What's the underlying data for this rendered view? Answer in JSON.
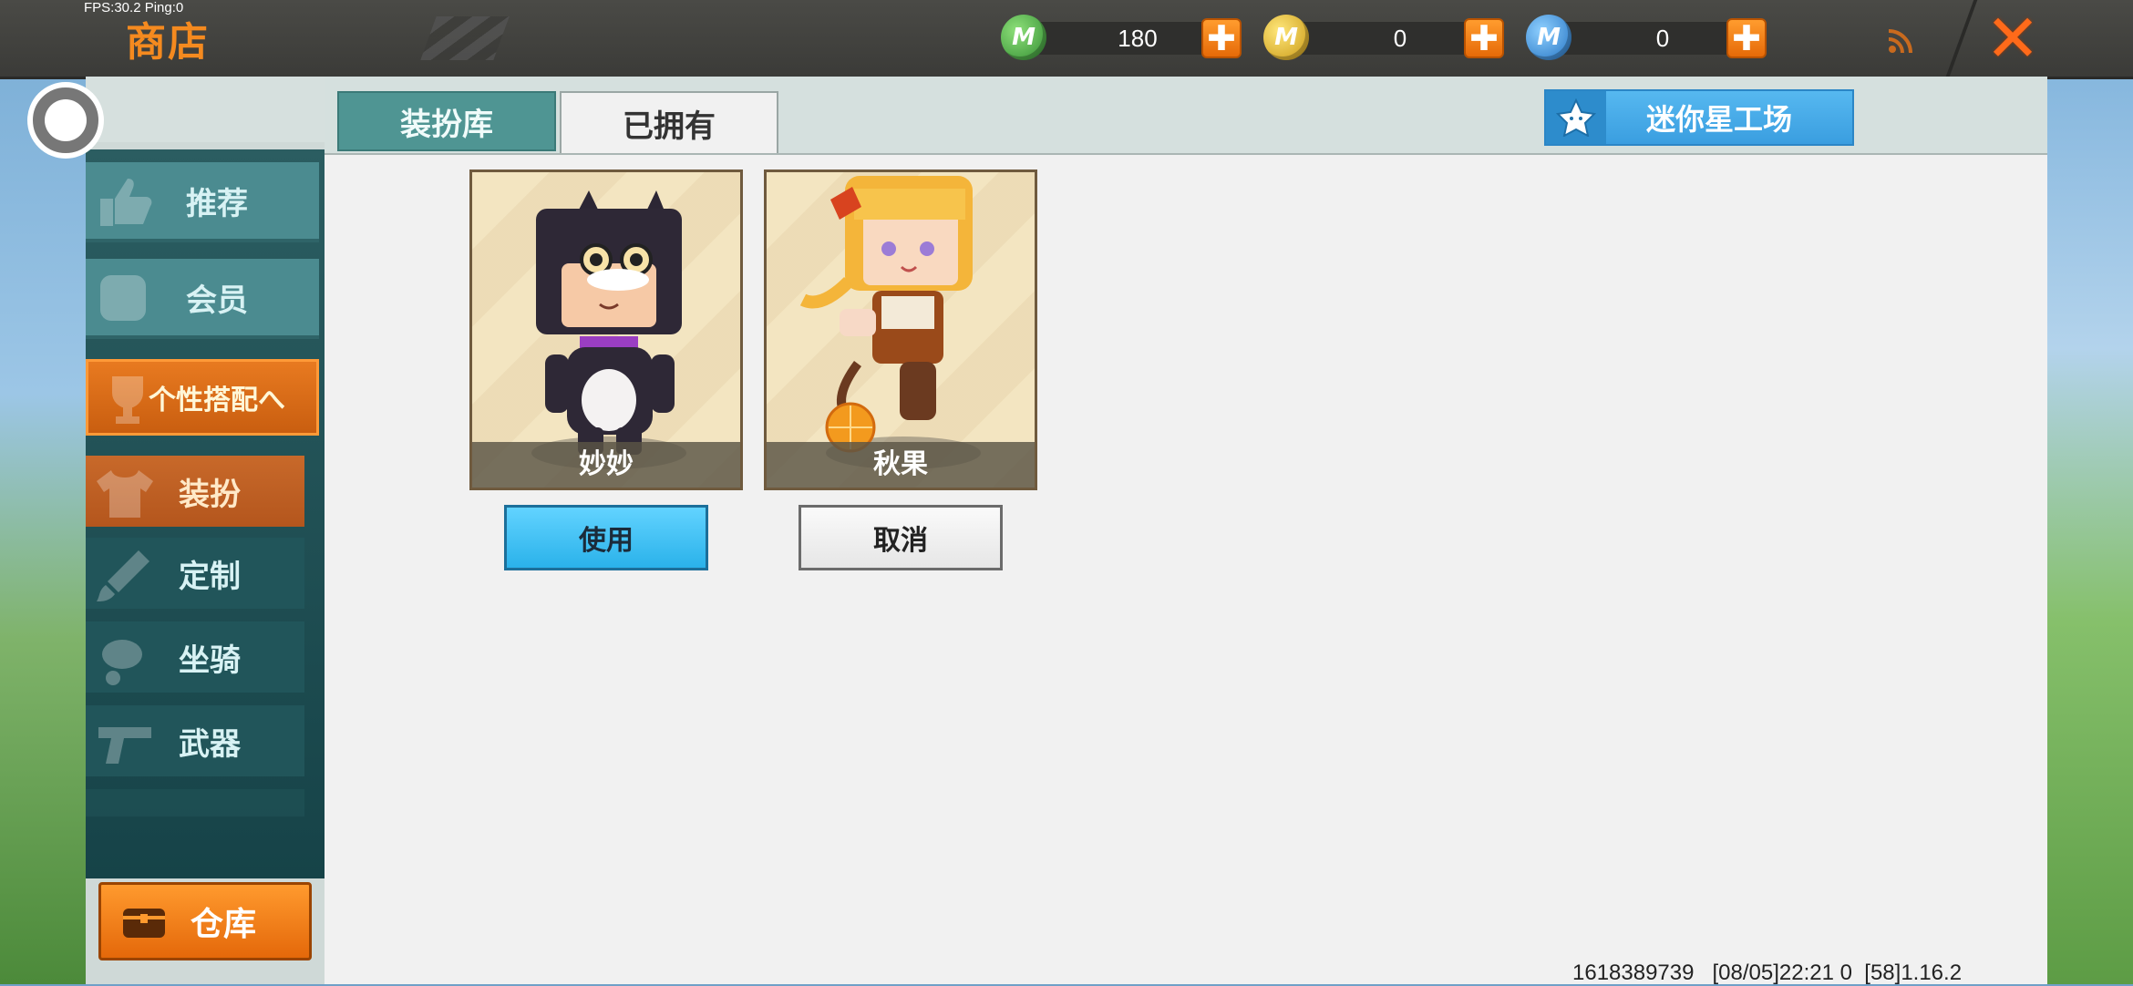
{
  "status": {
    "fps_text": "FPS:30.2  Ping:0"
  },
  "header": {
    "title": "商店",
    "currencies": [
      {
        "icon": "green-gem-icon",
        "value": "180",
        "color": "#3aa53a",
        "letter": "M"
      },
      {
        "icon": "gold-coin-icon",
        "value": "0",
        "color": "#e0b31c",
        "letter": "M"
      },
      {
        "icon": "blue-coin-icon",
        "value": "0",
        "color": "#2f8fdc",
        "letter": "M"
      }
    ],
    "plus_symbol": "✚",
    "close_symbol": "✕"
  },
  "sidebar": {
    "items": [
      {
        "label": "推荐",
        "icon": "thumbs-up-icon"
      },
      {
        "label": "会员",
        "icon": "member-icon"
      },
      {
        "label": "个性搭配へ",
        "icon": "trophy-icon"
      },
      {
        "label": "装扮",
        "icon": "shirt-icon"
      },
      {
        "label": "定制",
        "icon": "brush-icon"
      },
      {
        "label": "坐骑",
        "icon": "mount-icon"
      },
      {
        "label": "武器",
        "icon": "gun-icon"
      }
    ],
    "warehouse_label": "仓库"
  },
  "tabs": [
    {
      "label": "装扮库",
      "active": false
    },
    {
      "label": "已拥有",
      "active": true
    }
  ],
  "workshop_label": "迷你星工场",
  "skins": [
    {
      "name": "妙妙",
      "action": "使用"
    },
    {
      "name": "秋果",
      "action": "取消"
    }
  ],
  "footer": {
    "info": "1618389739   [08/05]22:21 0  [58]1.16.2"
  },
  "colors": {
    "accent": "#f58a1f",
    "primary_button": "#2ab2ea",
    "sidebar_dark": "#164348"
  }
}
